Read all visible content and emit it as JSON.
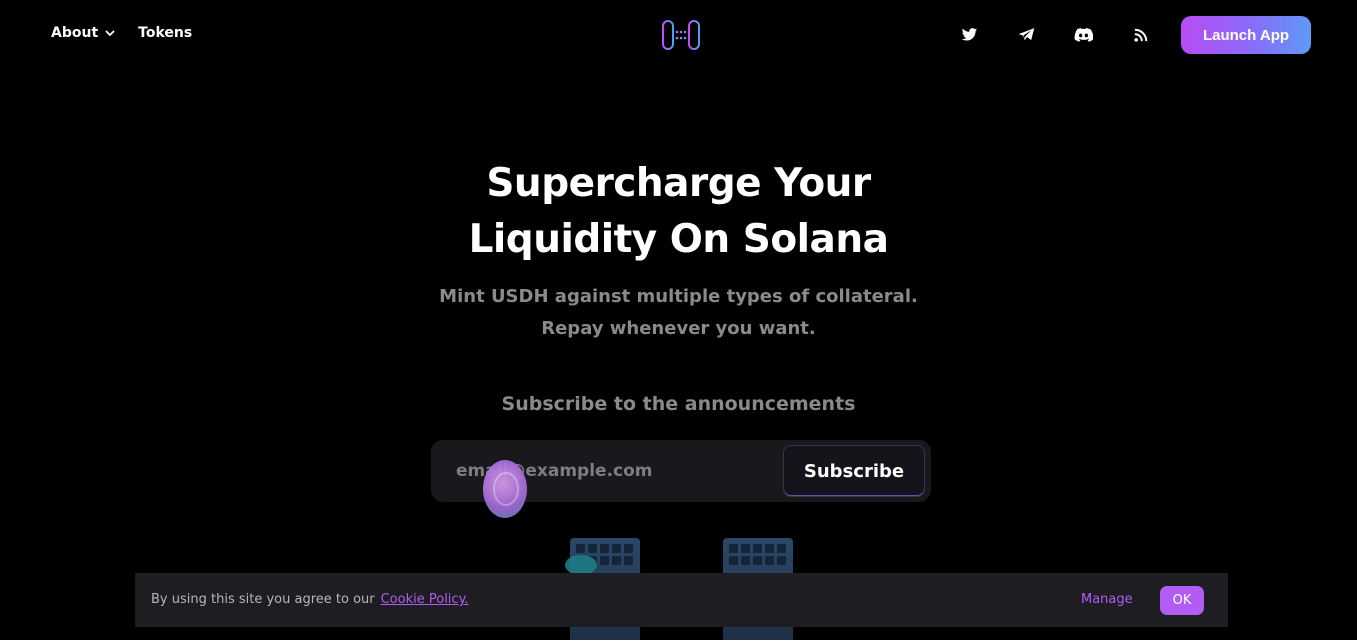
{
  "nav": {
    "about_label": "About",
    "tokens_label": "Tokens",
    "launch_label": "Launch App",
    "socials": [
      "twitter-icon",
      "telegram-icon",
      "discord-icon",
      "rss-icon"
    ]
  },
  "hero": {
    "title_line1": "Supercharge Your",
    "title_line2": "Liquidity On Solana",
    "subtitle_line1": "Mint USDH against multiple types of collateral.",
    "subtitle_line2": "Repay whenever you want."
  },
  "subscribe": {
    "heading": "Subscribe to the announcements",
    "placeholder": "email@example.com",
    "button_label": "Subscribe"
  },
  "cookie": {
    "text": "By using this site you agree to our",
    "link_label": "Cookie Policy.",
    "manage_label": "Manage",
    "ok_label": "OK"
  },
  "colors": {
    "accent": "#b15cf2",
    "launch_gradient_start": "#b84cf5",
    "launch_gradient_end": "#5f9af7",
    "background": "#000000"
  }
}
